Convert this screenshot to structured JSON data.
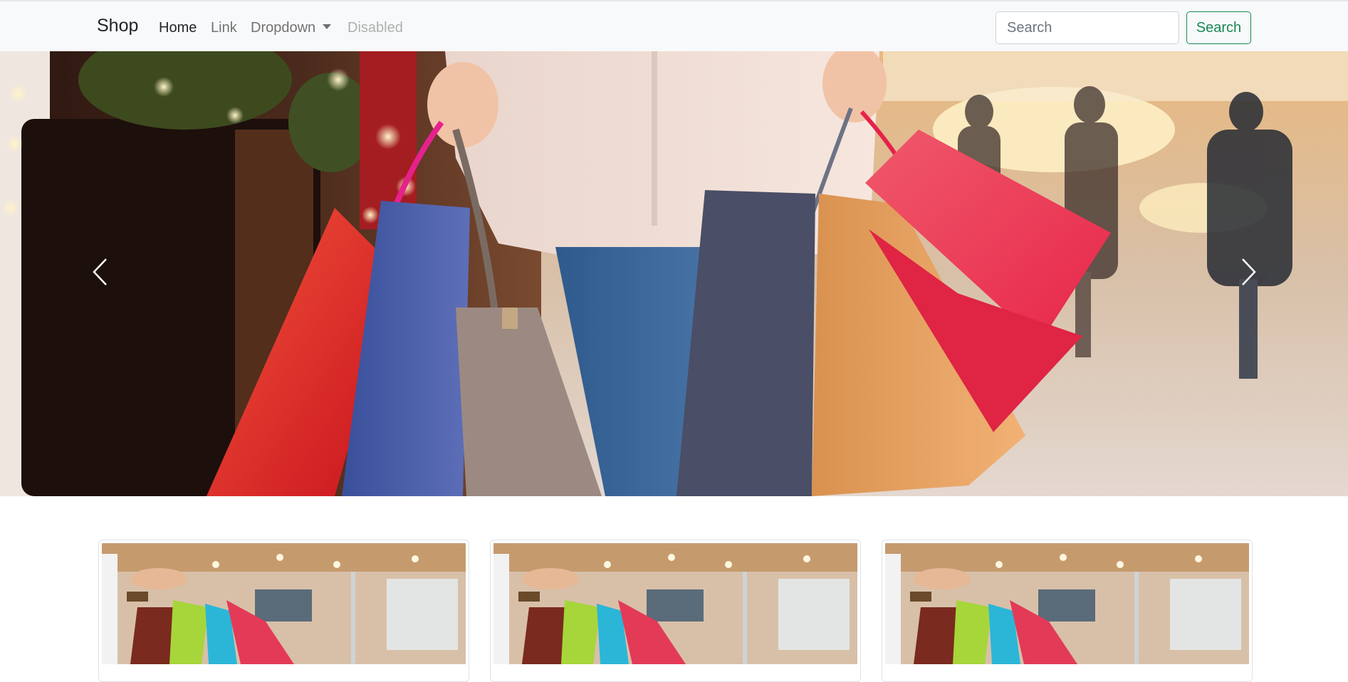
{
  "navbar": {
    "brand": "Shop",
    "links": [
      {
        "label": "Home",
        "state": "active"
      },
      {
        "label": "Link",
        "state": "normal"
      },
      {
        "label": "Dropdown",
        "state": "normal"
      },
      {
        "label": "Disabled",
        "state": "disabled"
      }
    ],
    "search": {
      "placeholder": "Search",
      "value": "",
      "button_label": "Search"
    }
  },
  "carousel": {
    "prev_icon": "chevron-left-icon",
    "next_icon": "chevron-right-icon",
    "image": "shopping-bags-photo"
  },
  "cards": [
    {
      "image": "shopping-bags-store-photo"
    },
    {
      "image": "shopping-bags-store-photo"
    },
    {
      "image": "shopping-bags-store-photo"
    }
  ],
  "colors": {
    "navbar_bg": "#f8f9fa",
    "button_outline_success": "#198754",
    "link_muted": "#6c757d"
  }
}
